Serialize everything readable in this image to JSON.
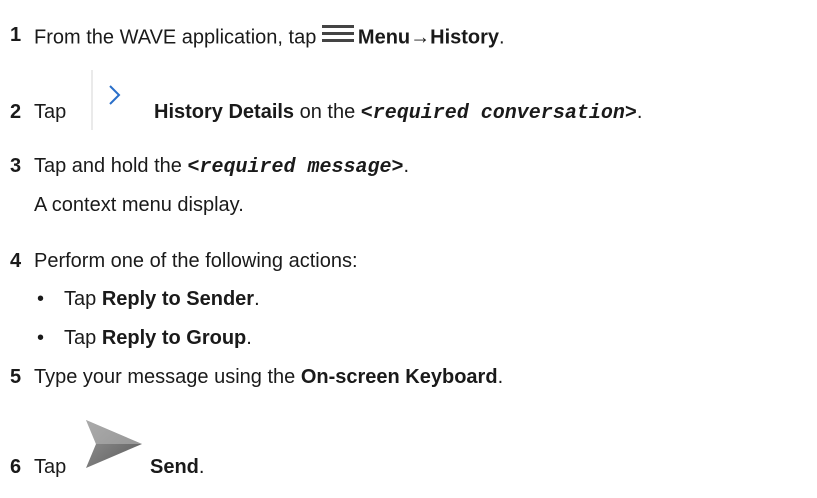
{
  "steps": [
    {
      "num": "1",
      "pre": "From the WAVE application, tap ",
      "icon": "hamburger-menu-icon",
      "bold": "Menu→History",
      "post": "."
    },
    {
      "num": "2",
      "pre": "Tap ",
      "icon": "chevron-right-icon",
      "bold": "History Details",
      "mid": " on the ",
      "mono": "<required conversation>",
      "post": "."
    },
    {
      "num": "3",
      "pre": "Tap and hold the ",
      "mono": "<required message>",
      "post": ".",
      "note": "A context menu display."
    },
    {
      "num": "4",
      "pre": "Perform one of the following actions:"
    },
    {
      "num": "5",
      "pre": "Type your message using the ",
      "bold": "On-screen Keyboard",
      "post": "."
    },
    {
      "num": "6",
      "pre": "Tap ",
      "icon": "send-arrow-icon",
      "bold": "Send",
      "post": "."
    }
  ],
  "sub_actions": [
    {
      "bullet": "•",
      "pre": "Tap ",
      "bold": "Reply to Sender",
      "post": "."
    },
    {
      "bullet": "•",
      "pre": "Tap ",
      "bold": "Reply to Group",
      "post": "."
    }
  ]
}
